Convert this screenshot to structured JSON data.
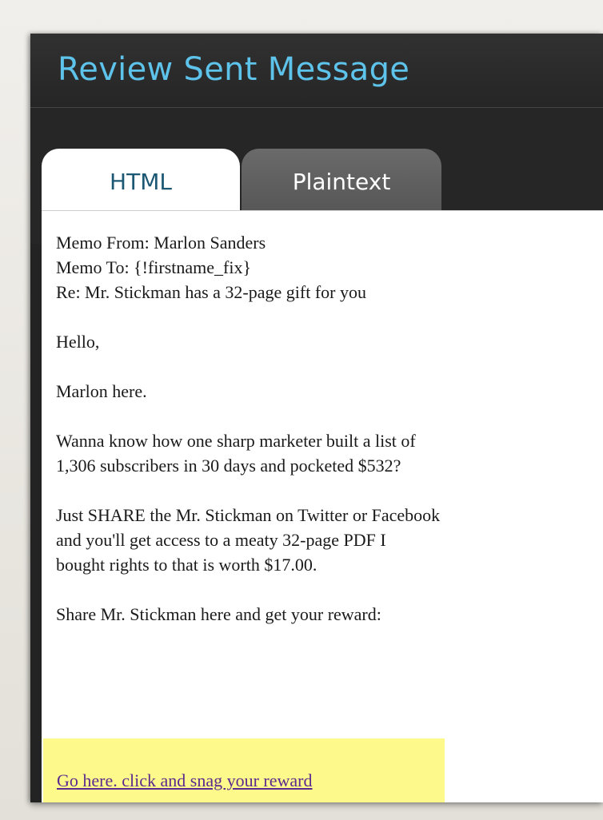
{
  "window": {
    "title": "Review Sent Message"
  },
  "tabs": [
    {
      "label": "HTML",
      "selected": true
    },
    {
      "label": "Plaintext",
      "selected": false
    }
  ],
  "message": {
    "memo_from": " Memo From: Marlon Sanders",
    "memo_to": "Memo To: {!firstname_fix}",
    "re": "Re:  Mr. Stickman has a 32-page gift for you",
    "greeting": "Hello,",
    "intro": "Marlon here.",
    "para1_line1": "Wanna know how one sharp marketer built a list of",
    "para1_line2": "1,306 subscribers in 30 days and pocketed $532?",
    "para2_line1": "Just SHARE the Mr. Stickman on Twitter or Facebook",
    "para2_line2": "and you'll get access to a meaty 32-page PDF I",
    "para2_line3": "bought rights to that is worth $17.00.",
    "share_line": "Share Mr. Stickman here and get your reward:",
    "link_text": "Go here. click and snag your reward"
  },
  "colors": {
    "title": "#5ec3ea",
    "tab_active_text": "#1c5874",
    "link": "#5b2a8f",
    "highlight": "#fdf98a"
  }
}
